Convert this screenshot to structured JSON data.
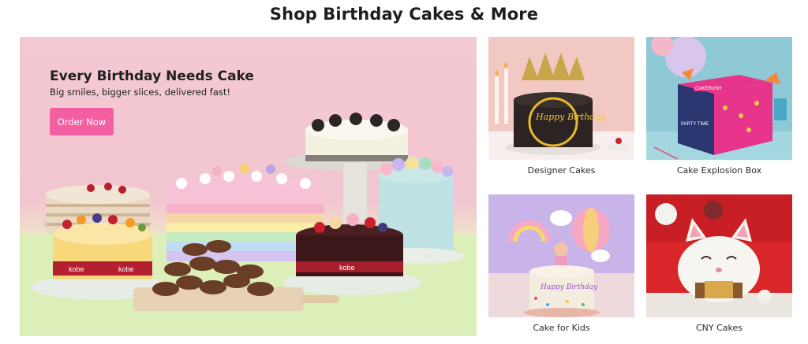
{
  "section": {
    "title": "Shop Birthday Cakes & More"
  },
  "hero": {
    "title": "Every Birthday Needs Cake",
    "subtitle": "Big smiles, bigger slices, delivered fast!",
    "button_label": "Order Now",
    "brand_text": "kobe"
  },
  "tiles": [
    {
      "label": "Designer Cakes",
      "topper_text": "Happy Birthday"
    },
    {
      "label": "Cake Explosion Box",
      "box_text": "CAKERUSH",
      "box_side_text": "PARTY TIME"
    },
    {
      "label": "Cake for Kids",
      "topper_text": "Happy Birthday"
    },
    {
      "label": "CNY Cakes"
    }
  ],
  "colors": {
    "button": "#f45fa1",
    "hero_background": "#f2c6d0",
    "hero_floor": "#dff0bd",
    "ribbon": "#b01f2e"
  }
}
